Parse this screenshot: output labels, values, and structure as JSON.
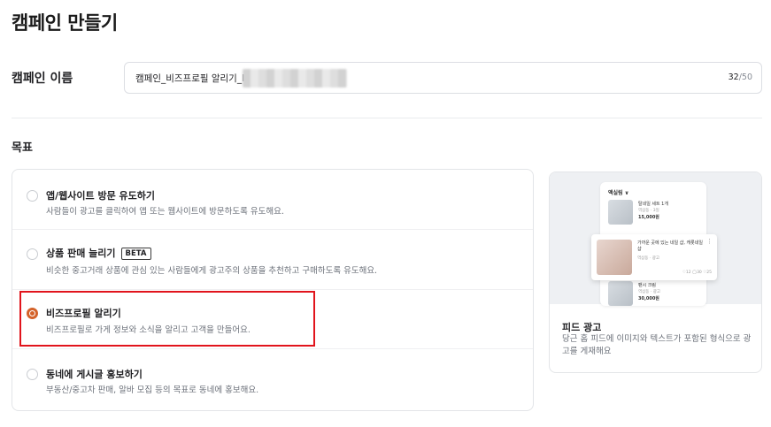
{
  "page_title": "캠페인 만들기",
  "campaign_name": {
    "label": "캠페인 이름",
    "value": "캠페인_비즈프로필 알리기_I",
    "count": "32",
    "max": "/50"
  },
  "goal": {
    "label": "목표",
    "options": [
      {
        "title": "앱/웹사이트 방문 유도하기",
        "desc": "사람들이 광고를 클릭하여 앱 또는 웹사이트에 방문하도록 유도해요.",
        "selected": false
      },
      {
        "title": "상품 판매 늘리기",
        "badge": "BETA",
        "desc": "비슷한 중고거래 상품에 관심 있는 사람들에게 광고주의 상품을 추천하고 구매하도록 유도해요.",
        "selected": false
      },
      {
        "title": "비즈프로필 알리기",
        "desc": "비즈프로필로 가게 정보와 소식을 알리고 고객을 만들어요.",
        "selected": true
      },
      {
        "title": "동네에 게시글 홍보하기",
        "desc": "부동산/중고차 판매, 알바 모집 등의 목표로 동네에 홍보해요.",
        "selected": false
      }
    ]
  },
  "preview": {
    "phone_header": "액실림 ∨",
    "rows": [
      {
        "t1": "탈네일 세트 1개",
        "t2": "역삼동 · 3일",
        "t3": "15,000원"
      },
      {
        "t1": "팬시 크림",
        "t2": "역삼동 · 광고",
        "t3": "30,000원"
      }
    ],
    "popout": {
      "t1": "가까운 곳에 있는 네일 샵, 캐롯네일샵",
      "t2": "역삼동 · 광고",
      "t3": "♡12 ◯30 ♡25"
    },
    "title": "피드 광고",
    "desc": "당근 홈 피드에 이미지와 텍스트가 포함된 형식으로 광고를 게재해요"
  },
  "colors": {
    "accent": "#d4622a",
    "highlight": "#e1141c"
  }
}
